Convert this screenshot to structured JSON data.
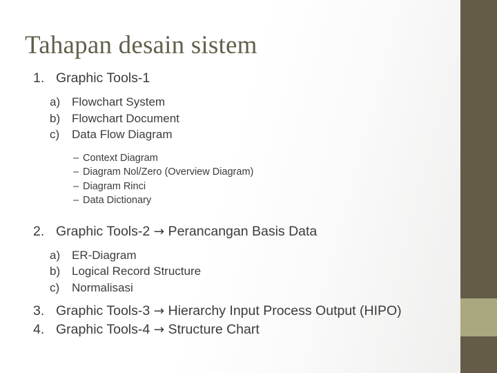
{
  "slide": {
    "title": "Tahapan desain sistem",
    "title_color": "#645f4b",
    "body_color": "#3b3b39",
    "background_color": "#ffffff",
    "accent_dark": "#645c47",
    "accent_light": "#aaa87e",
    "arrow_glyph": "→"
  },
  "content": {
    "item1": {
      "marker": "1.",
      "text": "Graphic Tools-1",
      "sub": [
        {
          "marker": "a)",
          "text": "Flowchart System"
        },
        {
          "marker": "b)",
          "text": "Flowchart Document"
        },
        {
          "marker": "c)",
          "text": "Data Flow Diagram"
        }
      ],
      "subsub": [
        {
          "marker": "–",
          "text": "Context Diagram"
        },
        {
          "marker": "–",
          "text": "Diagram Nol/Zero (Overview Diagram)"
        },
        {
          "marker": "–",
          "text": "Diagram Rinci"
        },
        {
          "marker": "–",
          "text": "Data Dictionary"
        }
      ]
    },
    "item2": {
      "marker": "2.",
      "text_before_arrow": "Graphic Tools-2 ",
      "text_after_arrow": " Perancangan Basis Data",
      "sub": [
        {
          "marker": "a)",
          "text": "ER-Diagram"
        },
        {
          "marker": "b)",
          "text": "Logical Record Structure"
        },
        {
          "marker": "c)",
          "text": "Normalisasi"
        }
      ]
    },
    "item3": {
      "marker": "3.",
      "text_before_arrow": "Graphic Tools-3 ",
      "text_after_arrow": " Hierarchy Input Process Output (HIPO)"
    },
    "item4": {
      "marker": "4.",
      "text_before_arrow": "Graphic Tools-4 ",
      "text_after_arrow": " Structure Chart"
    }
  }
}
